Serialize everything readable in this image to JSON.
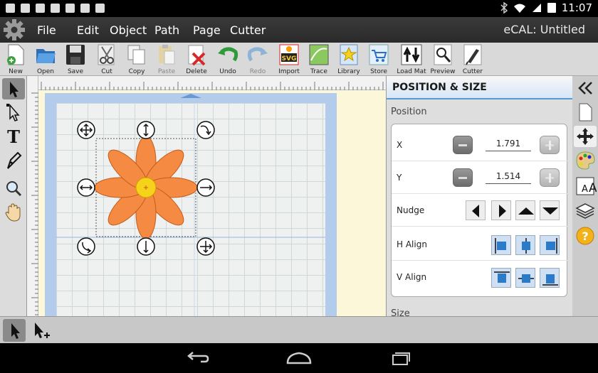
{
  "status_bar": {
    "time": "11:07"
  },
  "menu": {
    "items": [
      "File",
      "Edit",
      "Object",
      "Path",
      "Page",
      "Cutter"
    ],
    "app_title": "eCAL: Untitled"
  },
  "toolbar": {
    "buttons": [
      {
        "label": "New",
        "icon": "new-file-icon",
        "enabled": true
      },
      {
        "label": "Open",
        "icon": "open-folder-icon",
        "enabled": true
      },
      {
        "label": "Save",
        "icon": "floppy-disk-icon",
        "enabled": true
      },
      {
        "label": "Cut",
        "icon": "scissors-icon",
        "enabled": true
      },
      {
        "label": "Copy",
        "icon": "copy-icon",
        "enabled": true
      },
      {
        "label": "Paste",
        "icon": "paste-icon",
        "enabled": false
      },
      {
        "label": "Delete",
        "icon": "delete-icon",
        "enabled": true
      },
      {
        "label": "Undo",
        "icon": "undo-icon",
        "enabled": true
      },
      {
        "label": "Redo",
        "icon": "redo-icon",
        "enabled": false
      },
      {
        "label": "Import",
        "icon": "svg-import-icon",
        "enabled": true
      },
      {
        "label": "Trace",
        "icon": "trace-icon",
        "enabled": true
      },
      {
        "label": "Library",
        "icon": "library-star-icon",
        "enabled": true
      },
      {
        "label": "Store",
        "icon": "cart-icon",
        "enabled": true
      },
      {
        "label": "Load Mat",
        "icon": "load-mat-icon",
        "enabled": true
      },
      {
        "label": "Preview",
        "icon": "magnifier-icon",
        "enabled": true
      },
      {
        "label": "Cutter",
        "icon": "cutter-blade-icon",
        "enabled": true
      }
    ]
  },
  "left_tools": [
    "select-arrow-icon",
    "node-edit-icon",
    "text-tool-icon",
    "pen-tool-icon",
    "zoom-tool-icon",
    "hand-pan-icon"
  ],
  "canvas": {
    "shape": "flower",
    "petal_color": "#f58a42",
    "center_color": "#f7d21a",
    "mat_color": "#b3ccec",
    "work_bg": "#fdf7da"
  },
  "panel": {
    "title": "POSITION & SIZE",
    "position_label": "Position",
    "x_label": "X",
    "x_value": "1.791",
    "y_label": "Y",
    "y_value": "1.514",
    "nudge_label": "Nudge",
    "h_align_label": "H Align",
    "v_align_label": "V Align",
    "size_label": "Size"
  },
  "right_strip": [
    "collapse-panel-icon",
    "page-icon",
    "move-arrows-icon",
    "palette-icon",
    "font-size-icon",
    "layers-icon",
    "help-icon"
  ],
  "bottom_tools": [
    "select-arrow-icon",
    "add-select-arrow-icon"
  ],
  "accent": "#5b9bd5"
}
